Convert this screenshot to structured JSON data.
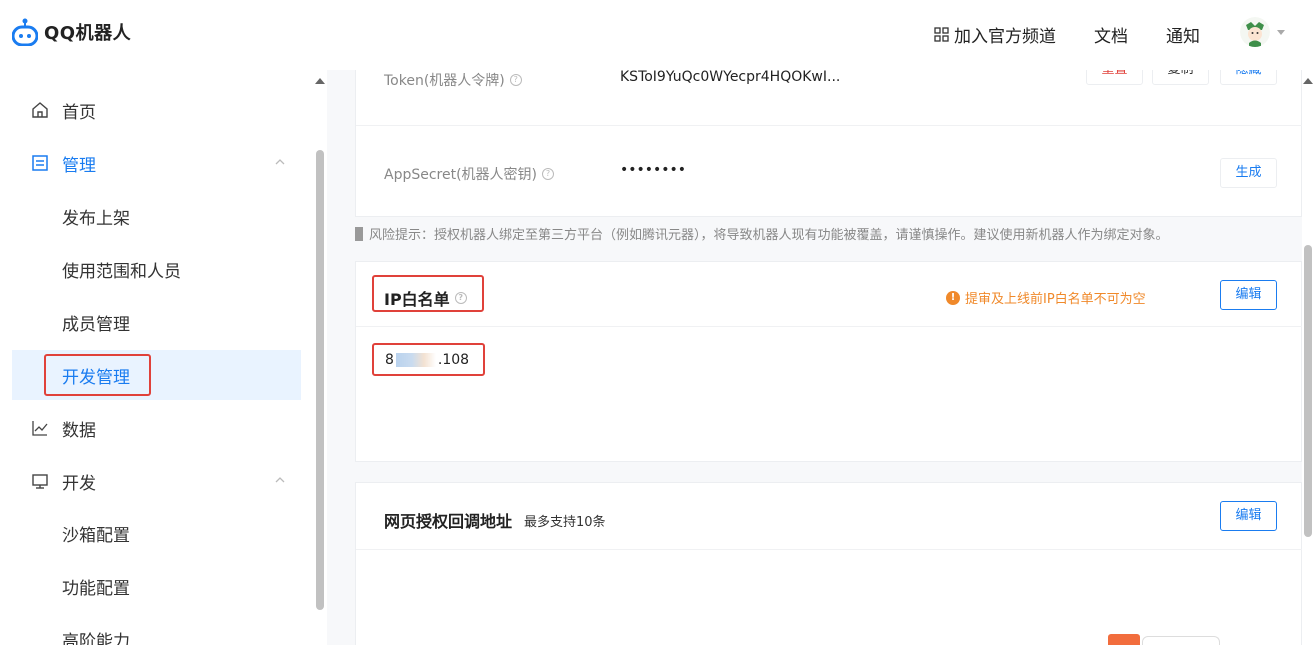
{
  "header": {
    "logo_text": "QQ机器人",
    "nav": {
      "channel": "加入官方频道",
      "docs": "文档",
      "notify": "通知"
    }
  },
  "sidebar": {
    "home": "首页",
    "manage": "管理",
    "manage_children": [
      "发布上架",
      "使用范围和人员",
      "成员管理",
      "开发管理"
    ],
    "data": "数据",
    "dev": "开发",
    "dev_children": [
      "沙箱配置",
      "功能配置",
      "高阶能力"
    ]
  },
  "credentials": {
    "token_label": "Token(机器人令牌)",
    "token_value": "KSToI9YuQc0WYecpr4HQOKwI...",
    "token_actions": {
      "reset": "重置",
      "copy": "复制",
      "hide": "隐藏"
    },
    "secret_label": "AppSecret(机器人密钥)",
    "secret_value": "••••••••",
    "secret_action": "生成"
  },
  "risk_notice": "风险提示：授权机器人绑定至第三方平台（例如腾讯元器），将导致机器人现有功能被覆盖，请谨慎操作。建议使用新机器人作为绑定对象。",
  "ip_whitelist": {
    "title": "IP白名单",
    "warning": "提审及上线前IP白名单不可为空",
    "edit": "编辑",
    "ip_prefix": "8",
    "ip_suffix": ".108"
  },
  "callback": {
    "title": "网页授权回调地址",
    "note": "最多支持10条",
    "edit": "编辑"
  },
  "colors": {
    "accent": "#1a7cf0",
    "warning": "#f0892a",
    "highlight": "#e0413a"
  }
}
